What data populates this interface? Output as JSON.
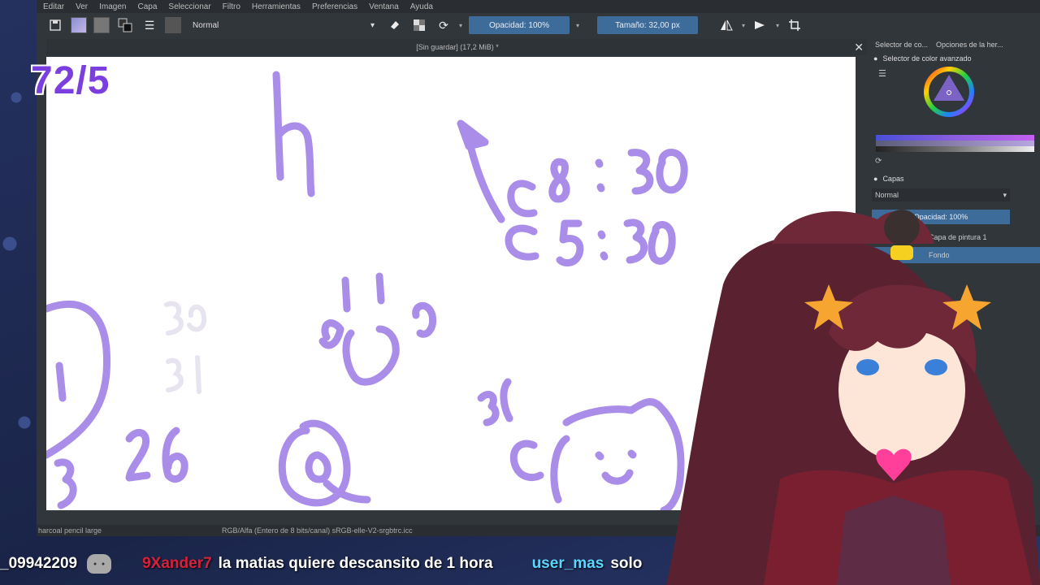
{
  "menu": [
    "Editar",
    "Ver",
    "Imagen",
    "Capa",
    "Seleccionar",
    "Filtro",
    "Herramientas",
    "Preferencias",
    "Ventana",
    "Ayuda"
  ],
  "toolbar": {
    "blend_mode": "Normal",
    "opacity_label": "Opacidad: 100%",
    "size_label": "Tamaño: 32,00 px"
  },
  "document": {
    "title": "[Sin guardar]  (17,2 MiB) *"
  },
  "status": {
    "brush": "harcoal pencil large",
    "color_space": "RGB/Alfa (Entero de 8 bits/canal)  sRGB-elle-V2-srgbtrc.icc"
  },
  "dockers": {
    "tabs": [
      "Selector de co...",
      "Opciones de la her..."
    ],
    "color_selector_title": "Selector de color avanzado",
    "layers_title": "Capas",
    "layers_blend": "Normal",
    "layers_opacity": "Opacidad:  100%",
    "layers": [
      "Capa de pintura 1",
      "Fondo"
    ]
  },
  "overlay": {
    "counter": "72/5"
  },
  "chat": {
    "partial_user": "_09942209",
    "message_user": "9Xander7",
    "message_text": "la matias quiere descansito de 1 hora",
    "next_user": "user_mas",
    "next_text": "solo"
  },
  "colors": {
    "brush_stroke": "#a98de8",
    "counter_text": "#7b3fe0",
    "opacity_slider": "#3d6b9a"
  }
}
